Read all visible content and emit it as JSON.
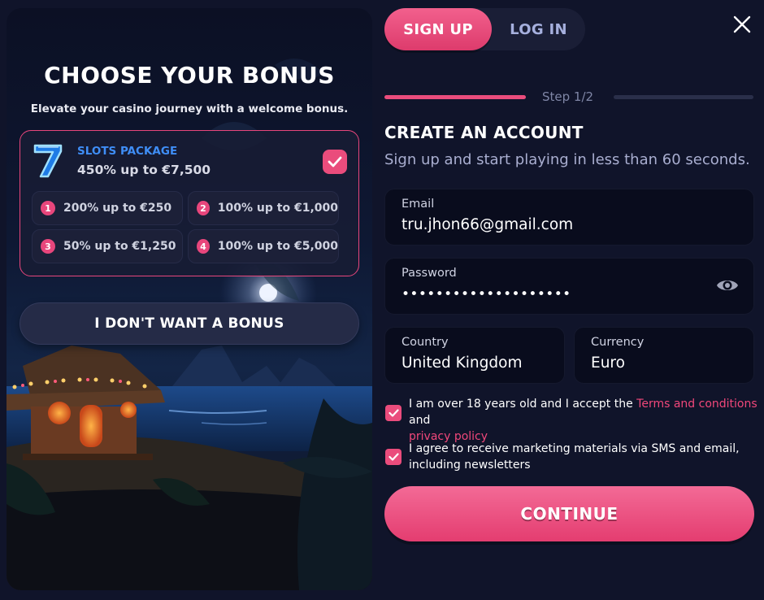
{
  "bonus_panel": {
    "title": "CHOOSE YOUR BONUS",
    "subtitle": "Elevate your casino journey with a welcome bonus.",
    "package": {
      "icon": "lucky-seven-icon",
      "name": "SLOTS PACKAGE",
      "value": "450% up to €7,500",
      "selected": true
    },
    "tiers": [
      {
        "number": "1",
        "text": "200% up to €250"
      },
      {
        "number": "2",
        "text": "100% up to €1,000"
      },
      {
        "number": "3",
        "text": "50% up to €1,250"
      },
      {
        "number": "4",
        "text": "100% up to €5,000"
      }
    ],
    "no_bonus_label": "I DON'T WANT A BONUS"
  },
  "auth_tabs": {
    "signup": "SIGN UP",
    "login": "LOG IN",
    "active": "signup"
  },
  "progress": {
    "step_text": "Step 1/2",
    "fraction": 0.5
  },
  "form": {
    "title": "CREATE AN ACCOUNT",
    "subtitle": "Sign up and start playing in less than 60 seconds.",
    "email": {
      "label": "Email",
      "value": "tru.jhon66@gmail.com"
    },
    "password": {
      "label": "Password",
      "value": "••••••••••••••••••••",
      "toggle_icon": "eye-icon"
    },
    "country": {
      "label": "Country",
      "value": "United Kingdom"
    },
    "currency": {
      "label": "Currency",
      "value": "Euro"
    },
    "terms": {
      "checked": true,
      "prefix": "I am over 18 years old and I accept the ",
      "terms_link": "Terms and conditions",
      "middle": " and",
      "privacy_link": "privacy policy"
    },
    "marketing": {
      "checked": true,
      "line1": "I agree to receive marketing materials via SMS and email,",
      "line2": "including newsletters"
    },
    "continue_label": "CONTINUE"
  },
  "colors": {
    "accent": "#ea4c7c",
    "background": "#10142a",
    "link": "#f0477a",
    "package_name": "#3f8ef7"
  }
}
